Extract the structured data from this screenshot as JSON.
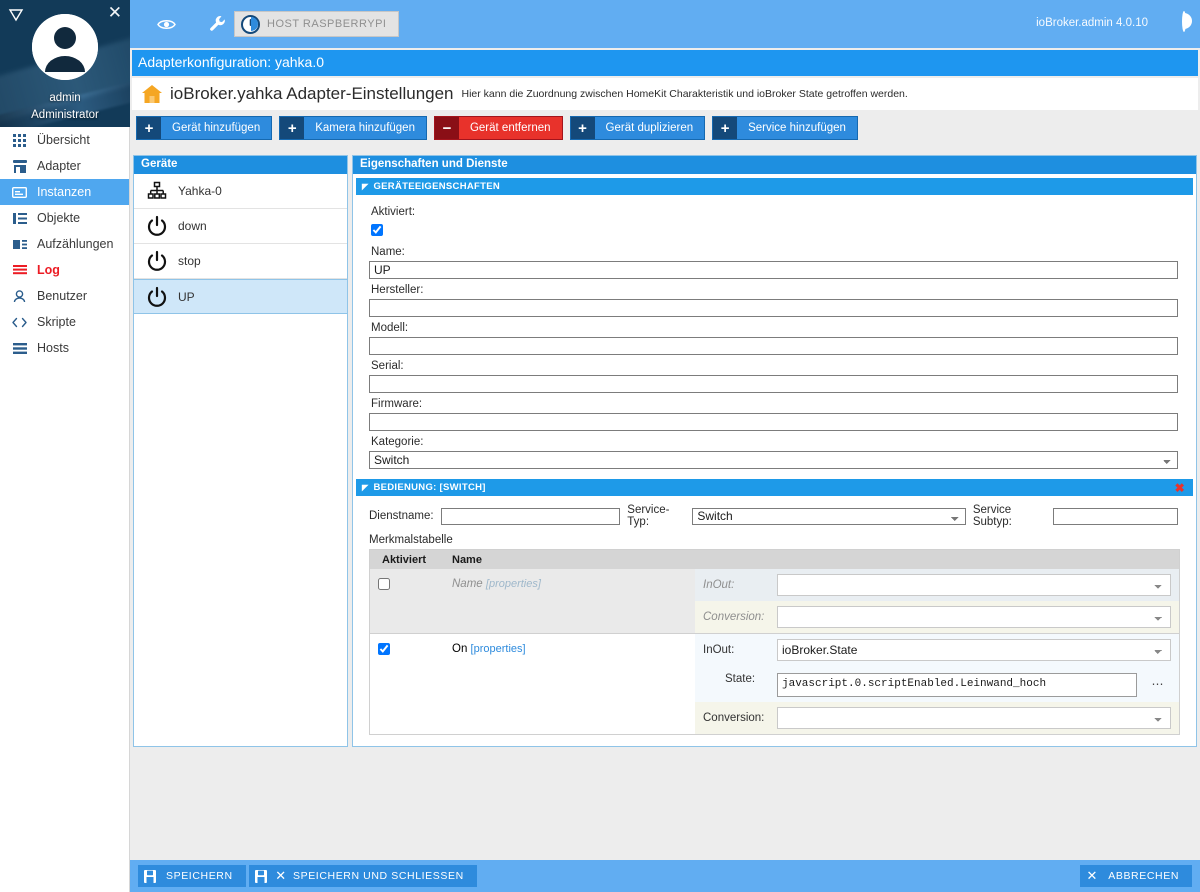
{
  "sidebar": {
    "logo_icon": "triangle-down-icon",
    "close_icon": "close-icon",
    "avatar_icon": "user-avatar-icon",
    "user": "admin",
    "role": "Administrator",
    "items": [
      {
        "label": "Übersicht",
        "icon": "grid-icon",
        "active": false,
        "alert": false
      },
      {
        "label": "Adapter",
        "icon": "store-icon",
        "active": false,
        "alert": false
      },
      {
        "label": "Instanzen",
        "icon": "instances-icon",
        "active": true,
        "alert": false
      },
      {
        "label": "Objekte",
        "icon": "list-icon",
        "active": false,
        "alert": false
      },
      {
        "label": "Aufzählungen",
        "icon": "enum-icon",
        "active": false,
        "alert": false
      },
      {
        "label": "Log",
        "icon": "log-lines-icon",
        "active": false,
        "alert": true
      },
      {
        "label": "Benutzer",
        "icon": "person-icon",
        "active": false,
        "alert": false
      },
      {
        "label": "Skripte",
        "icon": "code-brackets-icon",
        "active": false,
        "alert": false
      },
      {
        "label": "Hosts",
        "icon": "server-icon",
        "active": false,
        "alert": false
      }
    ]
  },
  "topbar": {
    "eye_icon": "eye-icon",
    "wrench_icon": "wrench-icon",
    "host_button": "HOST RASPBERRYPI",
    "host_icon": "iobroker-logo-icon",
    "version": "ioBroker.admin 4.0.10",
    "logo_icon": "iobroker-logo-icon"
  },
  "page": {
    "config_title": "Adapterkonfiguration: yahka.0",
    "home_icon": "home-icon",
    "adapter_title": "ioBroker.yahka Adapter-Einstellungen",
    "adapter_subtitle": "Hier kann die Zuordnung zwischen HomeKit Charakteristik und ioBroker State getroffen werden."
  },
  "toolbar": {
    "buttons": [
      {
        "label": "Gerät hinzufügen",
        "glyph": "+",
        "style": "primary"
      },
      {
        "label": "Kamera hinzufügen",
        "glyph": "+",
        "style": "primary"
      },
      {
        "label": "Gerät entfernen",
        "glyph": "−",
        "style": "danger"
      },
      {
        "label": "Gerät duplizieren",
        "glyph": "+",
        "style": "primary"
      },
      {
        "label": "Service hinzufügen",
        "glyph": "+",
        "style": "primary"
      }
    ]
  },
  "devices_panel": {
    "title": "Geräte",
    "items": [
      {
        "label": "Yahka-0",
        "icon": "sitemap-icon",
        "selected": false
      },
      {
        "label": "down",
        "icon": "power-icon",
        "selected": false
      },
      {
        "label": "stop",
        "icon": "power-icon",
        "selected": false
      },
      {
        "label": "UP",
        "icon": "power-icon",
        "selected": true
      }
    ]
  },
  "properties_panel": {
    "title": "Eigenschaften und Dienste",
    "device_section": {
      "header": "GERÄTEEIGENSCHAFTEN",
      "collapse_icon": "triangle-collapse-icon",
      "enabled_label": "Aktiviert:",
      "enabled_checked": true,
      "fields": [
        {
          "label": "Name:",
          "value": "UP",
          "type": "text",
          "placeholder": ""
        },
        {
          "label": "Hersteller:",
          "value": "",
          "type": "text",
          "placeholder": ""
        },
        {
          "label": "Modell:",
          "value": "",
          "type": "text",
          "placeholder": ""
        },
        {
          "label": "Serial:",
          "value": "",
          "type": "text",
          "placeholder": ""
        },
        {
          "label": "Firmware:",
          "value": "",
          "type": "text",
          "placeholder": ""
        },
        {
          "label": "Kategorie:",
          "value": "Switch",
          "type": "select",
          "placeholder": ""
        }
      ]
    },
    "service_section": {
      "header": "BEDIENUNG: [SWITCH]",
      "collapse_icon": "triangle-collapse-icon",
      "close_icon": "remove-service-icon",
      "service_name_label": "Dienstname:",
      "service_name_value": "",
      "service_type_label": "Service-Typ:",
      "service_type_value": "Switch",
      "service_subtype_label": "Service Subtyp:",
      "service_subtype_value": "",
      "table_caption": "Merkmalstabelle",
      "columns": [
        "Aktiviert",
        "Name"
      ],
      "rows": [
        {
          "enabled": false,
          "name": "Name",
          "properties_link": "[properties]",
          "inout_label": "InOut:",
          "inout_value": "",
          "conversion_label": "Conversion:",
          "conversion_value": "",
          "has_state": false
        },
        {
          "enabled": true,
          "name": "On",
          "properties_link": "[properties]",
          "inout_label": "InOut:",
          "inout_value": "ioBroker.State",
          "state_label": "State:",
          "state_value": "javascript.0.scriptEnabled.Leinwand_hoch",
          "state_browse_icon": "ellipsis-button-icon",
          "conversion_label": "Conversion:",
          "conversion_value": "",
          "has_state": true
        }
      ]
    }
  },
  "footer": {
    "save_label": "SPEICHERN",
    "save_close_label": "SPEICHERN UND SCHLIESSEN",
    "cancel_label": "ABBRECHEN",
    "save_icon": "floppy-disk-icon",
    "close_icon": "close-x-icon"
  },
  "colors": {
    "accent_blue": "#61adf2",
    "header_blue": "#1e96f0",
    "section_blue": "#1e9ae8",
    "button_blue": "#2e8bdd",
    "button_dark": "#14497a",
    "danger_red": "#e8322b",
    "log_red": "#ec1c24",
    "selection": "#cfe7f9"
  }
}
